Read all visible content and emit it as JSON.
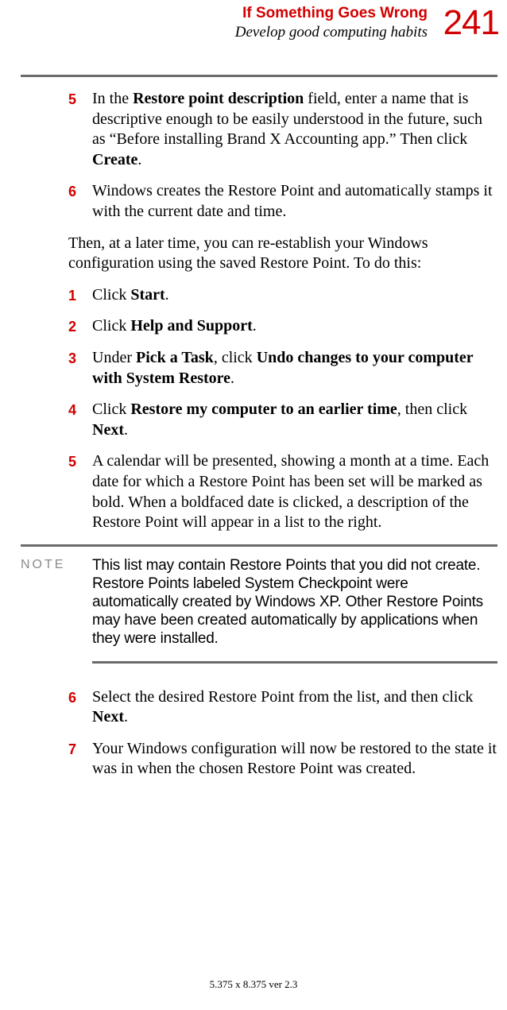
{
  "header": {
    "title": "If Something Goes Wrong",
    "subtitle": "Develop good computing habits",
    "page_number": "241"
  },
  "steps_a": [
    {
      "num": "5",
      "segments": [
        {
          "t": "In the "
        },
        {
          "t": "Restore point description",
          "b": true
        },
        {
          "t": " field, enter a name that is descriptive enough to be easily understood in the future, such as “Before installing Brand X Accounting app.” Then click "
        },
        {
          "t": "Create",
          "b": true
        },
        {
          "t": "."
        }
      ]
    },
    {
      "num": "6",
      "segments": [
        {
          "t": "Windows creates the Restore Point and automatically stamps it with the current date and time."
        }
      ]
    }
  ],
  "transition": "Then, at a later time, you can re-establish your Windows configuration using the saved Restore Point. To do this:",
  "steps_b": [
    {
      "num": "1",
      "segments": [
        {
          "t": "Click "
        },
        {
          "t": "Start",
          "b": true
        },
        {
          "t": "."
        }
      ]
    },
    {
      "num": "2",
      "segments": [
        {
          "t": "Click "
        },
        {
          "t": "Help and Support",
          "b": true
        },
        {
          "t": "."
        }
      ]
    },
    {
      "num": "3",
      "segments": [
        {
          "t": "Under "
        },
        {
          "t": "Pick a Task",
          "b": true
        },
        {
          "t": ", click "
        },
        {
          "t": "Undo changes to your computer with System Restore",
          "b": true
        },
        {
          "t": "."
        }
      ]
    },
    {
      "num": "4",
      "segments": [
        {
          "t": "Click "
        },
        {
          "t": "Restore my computer to an earlier time",
          "b": true
        },
        {
          "t": ", then click "
        },
        {
          "t": "Next",
          "b": true
        },
        {
          "t": "."
        }
      ]
    },
    {
      "num": "5",
      "segments": [
        {
          "t": "A calendar will be presented, showing a month at a time. Each date for which a Restore Point has been set will be marked as bold. When a boldfaced date is clicked, a description of the Restore Point will appear in a list to the right."
        }
      ]
    }
  ],
  "note": {
    "label": "NOTE",
    "text": "This list may contain Restore Points that you did not create. Restore Points labeled System Checkpoint were automatically created by Windows XP. Other Restore Points may have been created automatically by applications when they were installed."
  },
  "steps_c": [
    {
      "num": "6",
      "segments": [
        {
          "t": "Select the desired Restore Point from the list, and then click "
        },
        {
          "t": "Next",
          "b": true
        },
        {
          "t": "."
        }
      ]
    },
    {
      "num": "7",
      "segments": [
        {
          "t": "Your Windows configuration will now be restored to the state it was in when the chosen Restore Point was created."
        }
      ]
    }
  ],
  "footer": "5.375 x 8.375 ver 2.3"
}
